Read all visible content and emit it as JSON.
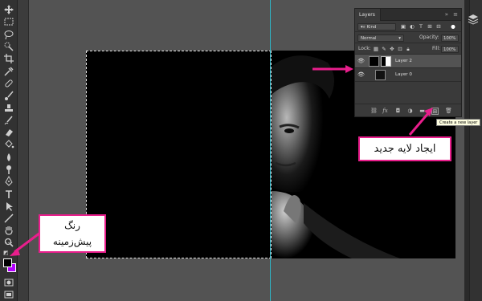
{
  "layers_panel": {
    "tab_title": "Layers",
    "collapse_glyph": "»",
    "menu_glyph": "≡",
    "filter_label": "Kind",
    "blend_mode": "Normal",
    "opacity_label": "Opacity:",
    "opacity_value": "100%",
    "lock_label": "Lock:",
    "fill_label": "Fill:",
    "fill_value": "100%",
    "layers": [
      {
        "name": "Layer 2",
        "visible": true,
        "selected": true
      },
      {
        "name": "Layer 0",
        "visible": true,
        "selected": false
      }
    ],
    "tooltip": "Create a new layer"
  },
  "annotations": {
    "new_layer": "ایجاد لایه جدید",
    "foreground_color_line1": "رنگ",
    "foreground_color_line2": "پیش‌زمینه"
  },
  "colors": {
    "accent_arrow": "#e91e8c",
    "foreground_swatch": "#000000",
    "background_swatch": "#b400ff",
    "guide": "#2fb4c4"
  },
  "icons": {
    "toolbar": [
      "move-icon",
      "marquee-icon",
      "lasso-icon",
      "quick-select-icon",
      "crop-icon",
      "eyedropper-icon",
      "healing-icon",
      "brush-icon",
      "stamp-icon",
      "history-brush-icon",
      "eraser-icon",
      "paint-bucket-icon",
      "blur-icon",
      "dodge-icon",
      "pen-icon",
      "type-icon",
      "path-select-icon",
      "line-icon",
      "hand-icon",
      "zoom-icon",
      "more-icon"
    ]
  }
}
